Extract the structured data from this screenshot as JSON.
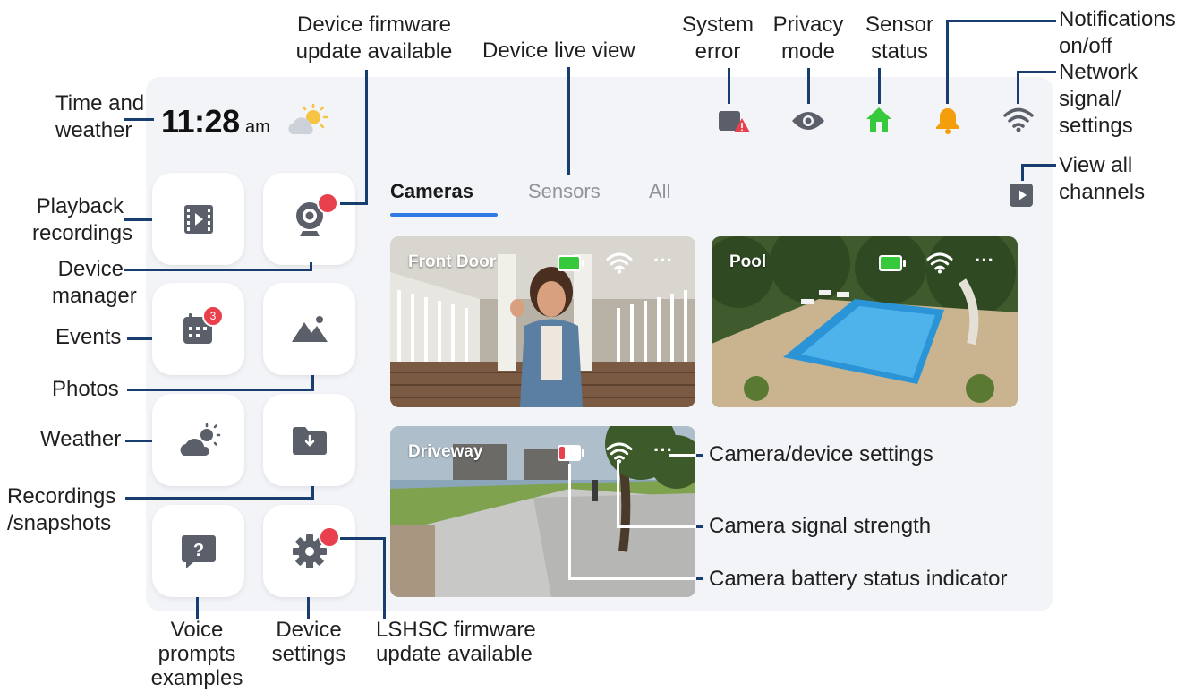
{
  "clock": {
    "time": "11:28",
    "ampm": "am"
  },
  "tabs": [
    {
      "label": "Cameras",
      "active": true
    },
    {
      "label": "Sensors",
      "active": false
    },
    {
      "label": "All",
      "active": false
    }
  ],
  "cameras": [
    {
      "name": "Front Door",
      "battery": "full",
      "more": "···"
    },
    {
      "name": "Pool",
      "battery": "full",
      "more": "···"
    },
    {
      "name": "Driveway",
      "battery": "low",
      "more": "···"
    }
  ],
  "events_badge": "3",
  "icons": {
    "weather": "partly-sunny-icon",
    "system_error": "system-error-icon",
    "privacy": "eye-icon",
    "sensor": "home-icon",
    "notifications": "bell-icon",
    "network": "wifi-icon",
    "view_all": "play-square-icon",
    "playback": "film-icon",
    "device_manager": "webcam-icon",
    "events": "calendar-icon",
    "photos": "mountain-icon",
    "weather_tile": "cloud-sun-icon",
    "recordings": "folder-download-icon",
    "voice": "question-bubble-icon",
    "settings": "gear-icon"
  },
  "colors": {
    "accent": "#2f7ae5",
    "line": "#173e6e",
    "red": "#e8414d",
    "green": "#37c93c",
    "orange": "#f59e0b"
  },
  "callouts": {
    "time_weather": "Time and\nweather",
    "firmware": "Device firmware\nupdate available",
    "live_view": "Device live view",
    "system_error": "System\nerror",
    "privacy": "Privacy\nmode",
    "sensor": "Sensor\nstatus",
    "notifications": "Notifications\non/off",
    "network": "Network\nsignal/\nsettings",
    "view_all": "View all\nchannels",
    "playback": "Playback\nrecordings",
    "device_manager": "Device\nmanager",
    "events": "Events",
    "photos": "Photos",
    "weather": "Weather",
    "recordings": "Recordings\n/snapshots",
    "voice": "Voice\nprompts\nexamples",
    "device_settings": "Device\nsettings",
    "lshsc": "LSHSC firmware\nupdate available",
    "cam_settings": "Camera/device settings",
    "cam_signal": "Camera signal strength",
    "cam_battery": "Camera battery status indicator"
  }
}
